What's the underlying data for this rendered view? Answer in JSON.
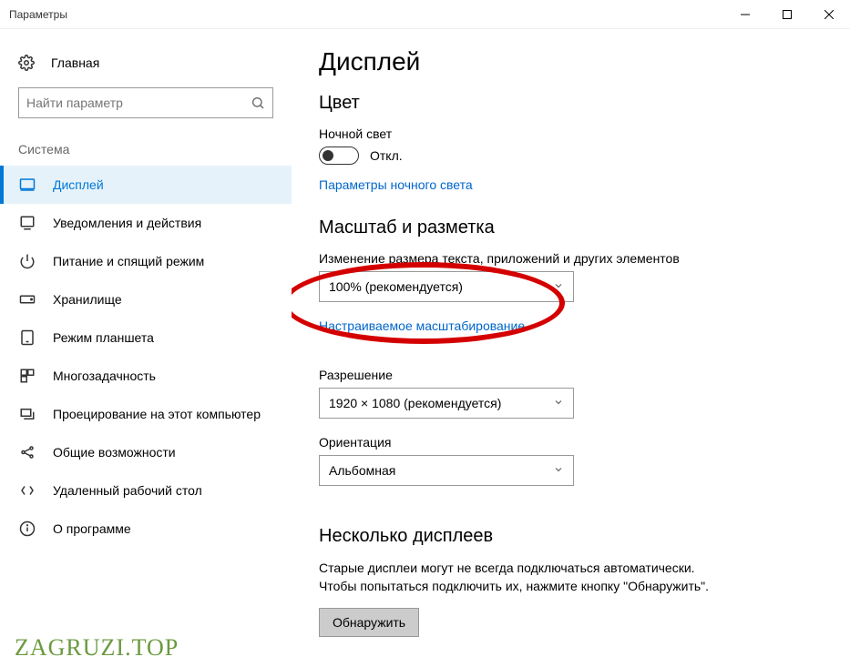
{
  "window": {
    "title": "Параметры"
  },
  "sidebar": {
    "home": "Главная",
    "search_placeholder": "Найти параметр",
    "group": "Система",
    "items": [
      {
        "label": "Дисплей"
      },
      {
        "label": "Уведомления и действия"
      },
      {
        "label": "Питание и спящий режим"
      },
      {
        "label": "Хранилище"
      },
      {
        "label": "Режим планшета"
      },
      {
        "label": "Многозадачность"
      },
      {
        "label": "Проецирование на этот компьютер"
      },
      {
        "label": "Общие возможности"
      },
      {
        "label": "Удаленный рабочий стол"
      },
      {
        "label": "О программе"
      }
    ]
  },
  "content": {
    "page_title": "Дисплей",
    "color_heading": "Цвет",
    "night_light_label": "Ночной свет",
    "night_light_state": "Откл.",
    "night_light_settings_link": "Параметры ночного света",
    "scale_heading": "Масштаб и разметка",
    "scale_label": "Изменение размера текста, приложений и других элементов",
    "scale_value": "100% (рекомендуется)",
    "custom_scaling_link": "Настраиваемое масштабирование",
    "resolution_label": "Разрешение",
    "resolution_value": "1920 × 1080 (рекомендуется)",
    "orientation_label": "Ориентация",
    "orientation_value": "Альбомная",
    "multi_heading": "Несколько дисплеев",
    "multi_desc": "Старые дисплеи могут не всегда подключаться автоматически. Чтобы попытаться подключить их, нажмите кнопку \"Обнаружить\".",
    "detect_button": "Обнаружить"
  },
  "watermark": "ZAGRUZI.TOP"
}
